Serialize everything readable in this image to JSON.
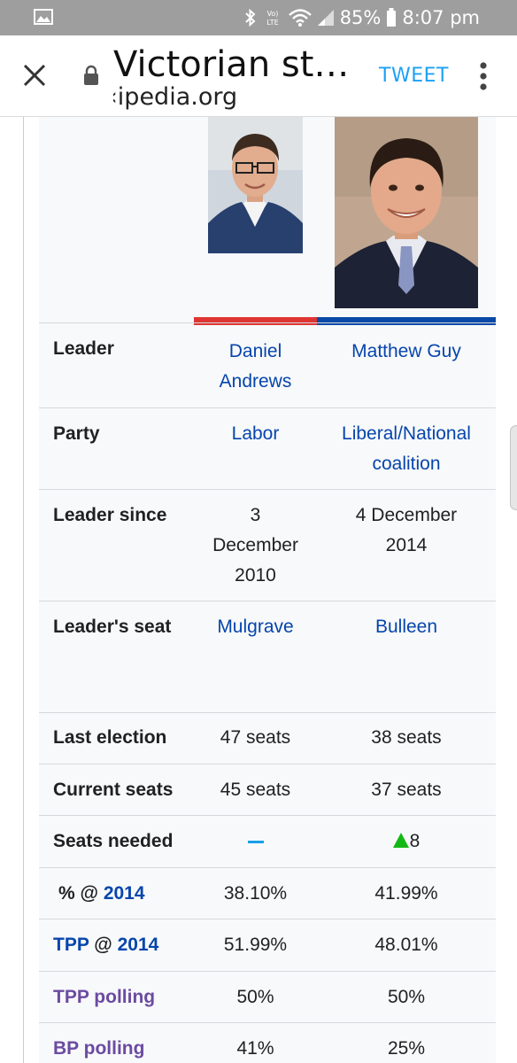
{
  "status_bar": {
    "battery": "85%",
    "time": "8:07 pm",
    "icons": [
      "gallery-icon",
      "bluetooth-icon",
      "volte-icon",
      "wifi-icon",
      "signal-icon",
      "battery-icon"
    ]
  },
  "top_bar": {
    "title": "Victorian st…",
    "domain": "‹ipedia.org",
    "tweet_label": "TWEET",
    "icons": [
      "close-icon",
      "lock-icon",
      "more-vert-icon"
    ]
  },
  "colors": {
    "labor": "#de3533",
    "liberal": "#0a49a6",
    "link": "#0645ad",
    "visited": "#6b4ba1",
    "tweet": "#1da1f2",
    "increase": "#14b814"
  },
  "infobox": {
    "rows": {
      "leader": {
        "label": "Leader",
        "a_line1": "Daniel",
        "a_line2": "Andrews",
        "b": "Matthew Guy"
      },
      "party": {
        "label": "Party",
        "a": "Labor",
        "b_line1": "Liberal/National",
        "b_line2": "coalition"
      },
      "leader_since": {
        "label": "Leader since",
        "a_line1": "3",
        "a_line2": "December",
        "a_line3": "2010",
        "b_line1": "4 December",
        "b_line2": "2014"
      },
      "leaders_seat": {
        "label": "Leader's seat",
        "a": "Mulgrave",
        "b": "Bulleen"
      },
      "last_election": {
        "label": "Last election",
        "a": "47 seats",
        "b": "38 seats"
      },
      "current_seats": {
        "label": "Current seats",
        "a": "45 seats",
        "b": "37 seats"
      },
      "seats_needed": {
        "label": "Seats needed",
        "a_icon": "dash-icon",
        "b_icon": "increase-triangle-icon",
        "b": "8"
      },
      "pct_2014": {
        "label_prefix": "% @ ",
        "label_link": "2014",
        "a": "38.10%",
        "b": "41.99%"
      },
      "tpp_2014": {
        "label_link1": "TPP",
        "label_mid": " @ ",
        "label_link2": "2014",
        "a": "51.99%",
        "b": "48.01%"
      },
      "tpp_polling": {
        "label": "TPP polling",
        "a": "50%",
        "b": "50%"
      },
      "bp_polling": {
        "label": "BP polling",
        "a": "41%",
        "b": "25%"
      }
    }
  }
}
